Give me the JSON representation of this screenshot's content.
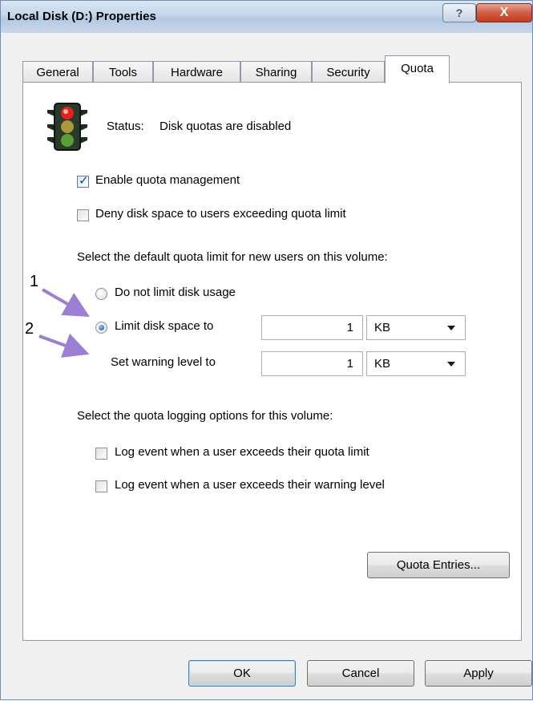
{
  "window": {
    "title": "Local Disk (D:) Properties",
    "help_glyph": "?",
    "close_glyph": "X"
  },
  "tabs": [
    "General",
    "Tools",
    "Hardware",
    "Sharing",
    "Security",
    "Quota"
  ],
  "active_tab": "Quota",
  "status": {
    "label": "Status:",
    "value": "Disk quotas are disabled",
    "icon": "traffic-light-icon"
  },
  "options": {
    "enable_quota_management": {
      "label": "Enable quota management",
      "checked": true
    },
    "deny_disk_space": {
      "label": "Deny disk space to users exceeding quota limit",
      "checked": false
    }
  },
  "default_limit": {
    "heading": "Select the default quota limit for new users on this volume:",
    "no_limit_label": "Do not limit disk usage",
    "limit_label": "Limit disk space to",
    "limit_value": "1",
    "limit_unit": "KB",
    "warning_label": "Set warning level to",
    "warning_value": "1",
    "warning_unit": "KB",
    "selected": "limit"
  },
  "logging": {
    "heading": "Select the quota logging options for this volume:",
    "log_limit_label": "Log event when a user exceeds their quota limit",
    "log_warning_label": "Log event when a user exceeds their warning level"
  },
  "buttons": {
    "quota_entries": "Quota Entries...",
    "ok": "OK",
    "cancel": "Cancel",
    "apply": "Apply"
  },
  "annotations": {
    "callout_1": "1",
    "callout_2": "2",
    "arrow_color": "#9b7fd4"
  },
  "colors": {
    "accent": "#3c7fb1",
    "tab_border": "#8e9aaa"
  }
}
